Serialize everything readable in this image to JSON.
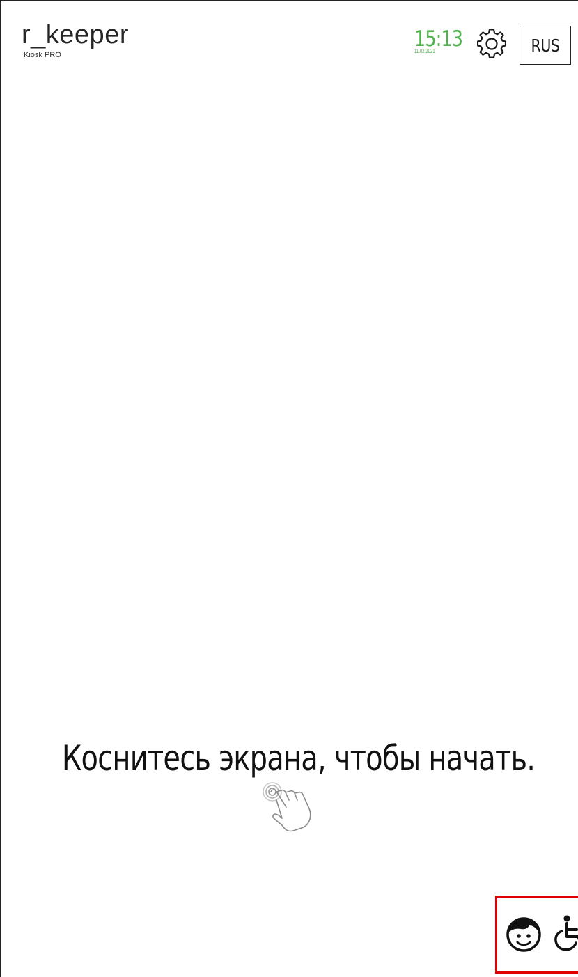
{
  "app": {
    "logo_title": "r_keeper",
    "logo_subtitle": "Kiosk PRO"
  },
  "header": {
    "time": "15:13",
    "date": "11.02.2021",
    "time_color": "#4fb24a",
    "settings_icon": "gear-icon",
    "language_label": "RUS"
  },
  "main": {
    "prompt_text": "Коснитесь экрана, чтобы начать.",
    "prompt_icon": "tap-hand-icon"
  },
  "accessibility": {
    "highlight_color": "#e00000",
    "kids_icon": "child-face-icon",
    "wheelchair_icon": "wheelchair-icon"
  }
}
